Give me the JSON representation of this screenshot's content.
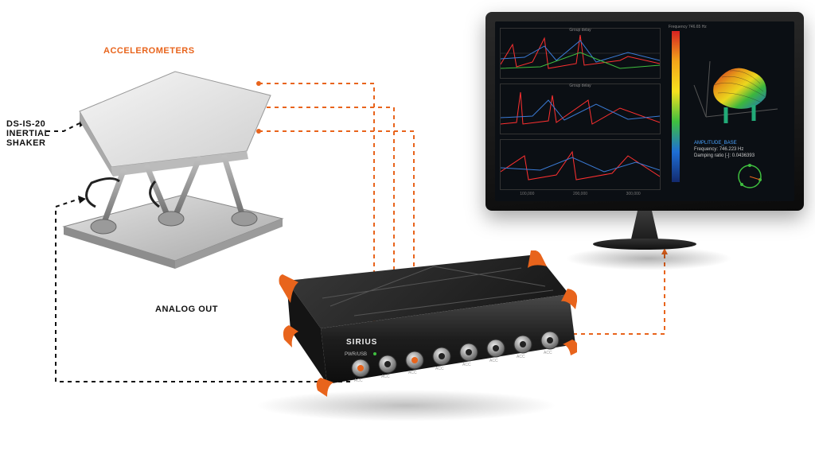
{
  "labels": {
    "accelerometers": "ACCELEROMETERS",
    "shaker": "DS-IS-20\nINERTIAL\nSHAKER",
    "analog_out": "ANALOG OUT"
  },
  "daq": {
    "brand": "SIRIUS",
    "pwr": "PWR/USB",
    "channels": [
      "ACC",
      "ACC",
      "ACC",
      "ACC",
      "ACC",
      "ACC",
      "ACC",
      "ACC"
    ]
  },
  "screen": {
    "colorbar_title": "Frequency 746.65 Hz",
    "plots": [
      {
        "title": "Group delay"
      },
      {
        "title": "Group delay"
      },
      {
        "title": ""
      }
    ],
    "xticks": [
      "100,000",
      "200,000",
      "300,000"
    ],
    "info_mode": "AMPLITUDE_BASE",
    "info_freq_label": "Frequency:",
    "info_freq_value": "746.223 Hz",
    "info_damp_label": "Damping ratio [-]:",
    "info_damp_value": "0.0436393"
  },
  "accent": "#e8641c"
}
